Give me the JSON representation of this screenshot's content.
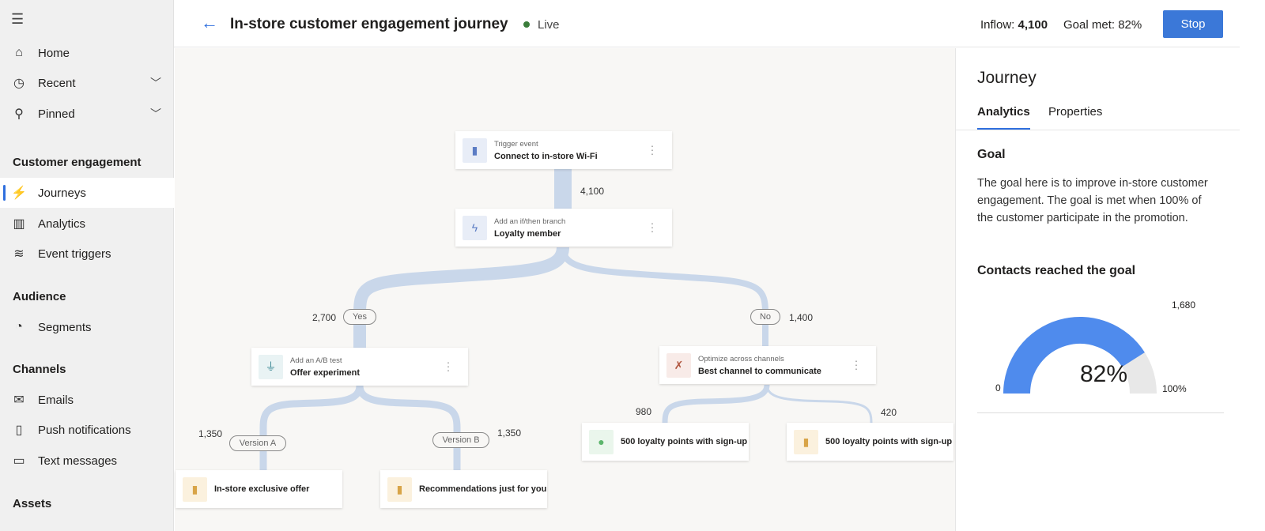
{
  "sidebar": {
    "menu_icon": "hamburger-icon",
    "items": [
      {
        "label": "Home",
        "icon": "home-icon"
      },
      {
        "label": "Recent",
        "icon": "clock-icon"
      },
      {
        "label": "Pinned",
        "icon": "pin-icon"
      }
    ],
    "sections": [
      {
        "title": "Customer engagement",
        "items": [
          {
            "label": "Journeys",
            "active": true
          },
          {
            "label": "Analytics"
          },
          {
            "label": "Event triggers"
          }
        ]
      },
      {
        "title": "Audience",
        "items": [
          {
            "label": "Segments"
          }
        ]
      },
      {
        "title": "Channels",
        "items": [
          {
            "label": "Emails"
          },
          {
            "label": "Push notifications"
          },
          {
            "label": "Text messages"
          }
        ]
      },
      {
        "title": "Assets",
        "items": []
      }
    ]
  },
  "header": {
    "title": "In-store customer engagement journey",
    "status": "Live",
    "inflow_label": "Inflow:",
    "inflow_value": "4,100",
    "goal_label": "Goal met:",
    "goal_value": "82%",
    "stop_label": "Stop"
  },
  "flow": {
    "trigger": {
      "sub": "Trigger event",
      "main": "Connect to in-store Wi-Fi"
    },
    "trigger_count": "4,100",
    "branch": {
      "sub": "Add an if/then branch",
      "main": "Loyalty member"
    },
    "yes_label": "Yes",
    "yes_count": "2,700",
    "no_label": "No",
    "no_count": "1,400",
    "abtest": {
      "sub": "Add an A/B test",
      "main": "Offer experiment"
    },
    "optimize": {
      "sub": "Optimize across channels",
      "main": "Best channel to communicate"
    },
    "version_a": "Version A",
    "version_a_count": "1,350",
    "version_b": "Version B",
    "version_b_count": "1,350",
    "offer_a": "In-store exclusive offer",
    "offer_b": "Recommendations just for you",
    "channel_1_count": "980",
    "channel_1": "500 loyalty points with sign-up",
    "channel_2_count": "420",
    "channel_2": "500 loyalty points with sign-up"
  },
  "panel": {
    "title": "Journey",
    "tabs": [
      "Analytics",
      "Properties"
    ],
    "goal_heading": "Goal",
    "goal_text": "The goal here is to improve in-store customer engagement. The goal is met when 100% of the customer participate in the promotion.",
    "contacts_heading": "Contacts reached the goal",
    "gauge": {
      "percent": 82,
      "percent_label": "82%",
      "min_label": "0",
      "max_label": "100%",
      "target_label": "1,680",
      "fill_color": "#4f8bed",
      "track_color": "#e8e8e8"
    }
  }
}
